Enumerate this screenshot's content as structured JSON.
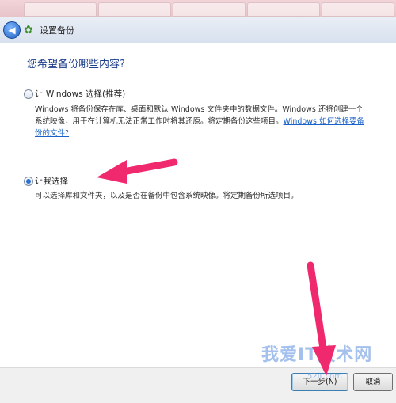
{
  "window": {
    "title": "设置备份",
    "back_icon": "back-arrow-icon",
    "app_icon": "backup-icon"
  },
  "content": {
    "heading": "您希望备份哪些内容?",
    "option_windows": {
      "label": "让 Windows 选择(推荐)",
      "selected": false,
      "desc_line1": "Windows 将备份保存在库、桌面和默认 Windows 文件夹中的数据文件。Windows 还将创建一个",
      "desc_line2_text": "系统映像，用于在计算机无法正常工作时将其还原。将定期备份这些项目。",
      "desc_link_part1": "Windows 如何选择要备",
      "desc_link_part2": "份的文件?"
    },
    "option_user": {
      "label": "让我选择",
      "selected": true,
      "desc": "可以选择库和文件夹，以及是否在备份中包含系统映像。将定期备份所选项目。"
    }
  },
  "footer": {
    "next_label": "下一步(N)",
    "cancel_label": "取消"
  },
  "watermark": {
    "text": "我爱IT技术网",
    "sub": "52it.com"
  },
  "colors": {
    "arrow": "#f0286e",
    "heading": "#1e3f8a",
    "link": "#1a62c7"
  }
}
